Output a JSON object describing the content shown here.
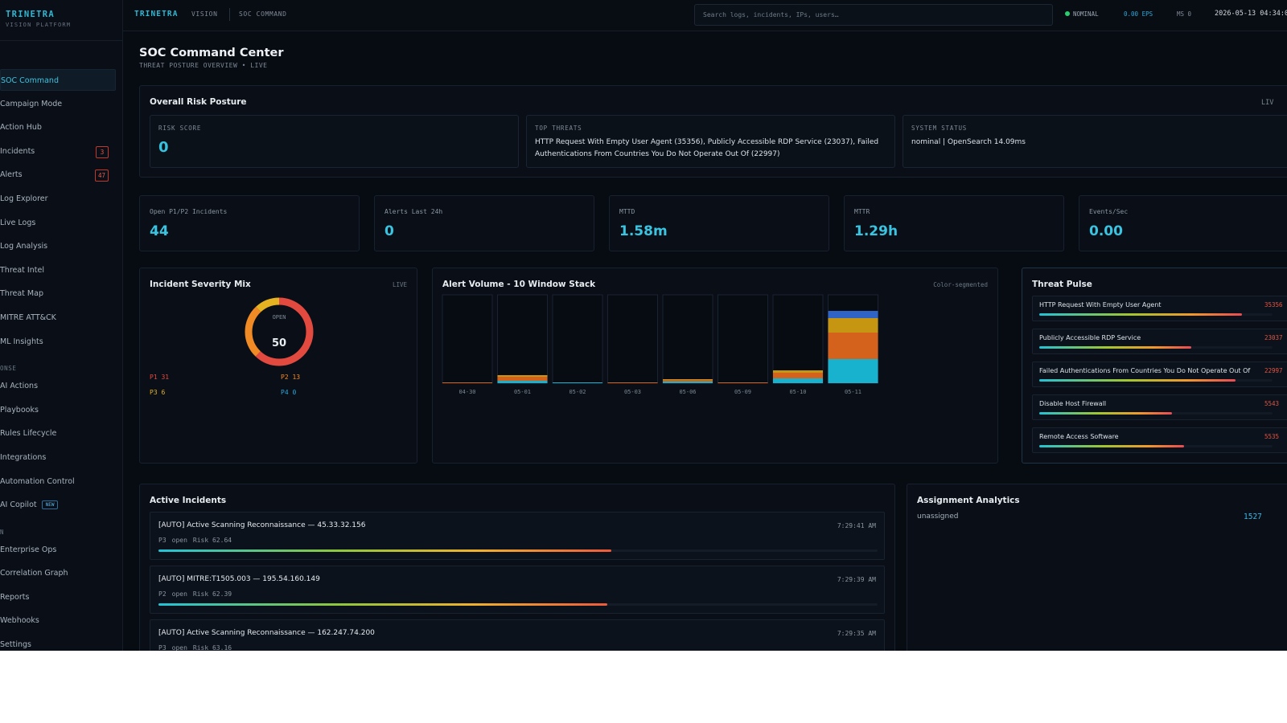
{
  "sidebar": {
    "brand": "TRINETRA",
    "brand_sub": "VISION PLATFORM",
    "items": [
      {
        "label": "SOC Command",
        "type": "item",
        "active": true
      },
      {
        "label": "Campaign Mode",
        "type": "item"
      },
      {
        "label": "Action Hub",
        "type": "item"
      },
      {
        "label": "Incidents",
        "type": "item",
        "badge": "3"
      },
      {
        "label": "Alerts",
        "type": "item",
        "badge": "47"
      },
      {
        "label": "Log Explorer",
        "type": "item"
      },
      {
        "label": "Live Logs",
        "type": "item"
      },
      {
        "label": "Log Analysis",
        "type": "item"
      },
      {
        "label": "Threat Intel",
        "type": "item"
      },
      {
        "label": "Threat Map",
        "type": "item"
      },
      {
        "label": "MITRE ATT&CK",
        "type": "item"
      },
      {
        "label": "ML Insights",
        "type": "item"
      },
      {
        "label": "ONSE",
        "type": "section"
      },
      {
        "label": "AI Actions",
        "type": "item"
      },
      {
        "label": "Playbooks",
        "type": "item"
      },
      {
        "label": "Rules Lifecycle",
        "type": "item"
      },
      {
        "label": "Integrations",
        "type": "item"
      },
      {
        "label": "Automation Control",
        "type": "item"
      },
      {
        "label": "AI Copilot",
        "type": "item",
        "tag": "NEW"
      },
      {
        "label": "N",
        "type": "section"
      },
      {
        "label": "Enterprise Ops",
        "type": "item"
      },
      {
        "label": "Correlation Graph",
        "type": "item"
      },
      {
        "label": "Reports",
        "type": "item"
      },
      {
        "label": "Webhooks",
        "type": "item"
      },
      {
        "label": "Settings",
        "type": "item"
      }
    ]
  },
  "topbar": {
    "brand": "TRINETRA",
    "vision": "VISION",
    "section": "SOC COMMAND",
    "search_placeholder": "Search logs, incidents, IPs, users…",
    "status": "NOMINAL",
    "eps": "0.00 EPS",
    "ms": "MS 0",
    "timestamp": "2026-05-13 04:34:0",
    "colors": {
      "status_dot": "#2ecc71",
      "accent": "#2fb8d4"
    }
  },
  "page": {
    "title": "SOC Command Center",
    "subtitle": "THREAT POSTURE OVERVIEW • LIVE"
  },
  "risk_posture": {
    "title": "Overall Risk Posture",
    "live": "LIV",
    "risk_score_label": "RISK SCORE",
    "risk_score": "0",
    "top_threats_label": "TOP THREATS",
    "top_threats": "HTTP Request With Empty User Agent (35356), Publicly Accessible RDP Service (23037), Failed Authentications From Countries You Do Not Operate Out Of (22997)",
    "system_status_label": "SYSTEM STATUS",
    "system_status": "nominal | OpenSearch 14.09ms"
  },
  "kpis": [
    {
      "label": "Open P1/P2 Incidents",
      "value": "44"
    },
    {
      "label": "Alerts Last 24h",
      "value": "0"
    },
    {
      "label": "MTTD",
      "value": "1.58m"
    },
    {
      "label": "MTTR",
      "value": "1.29h"
    },
    {
      "label": "Events/Sec",
      "value": "0.00"
    }
  ],
  "severity": {
    "title": "Incident Severity Mix",
    "tag": "LIVE",
    "center_label": "OPEN",
    "center_value": "50",
    "legend": [
      {
        "label": "P1 31",
        "color": "#e2493f"
      },
      {
        "label": "P2 13",
        "color": "#f08a24"
      },
      {
        "label": "P3 6",
        "color": "#e5b321"
      },
      {
        "label": "P4 0",
        "color": "#2aa6d9"
      }
    ],
    "chart_data": {
      "type": "pie",
      "labels": [
        "P1",
        "P2",
        "P3",
        "P4"
      ],
      "values": [
        31,
        13,
        6,
        0
      ],
      "colors": [
        "#e2493f",
        "#f08a24",
        "#e5b321",
        "#2aa6d9"
      ]
    }
  },
  "volume": {
    "title": "Alert Volume - 10 Window Stack",
    "tag": "Color-segmented",
    "chart_data": {
      "type": "bar",
      "stacked": true,
      "categories": [
        "04-30",
        "05-01",
        "05-02",
        "05-03",
        "05-06",
        "05-09",
        "05-10",
        "05-11"
      ],
      "series": [
        {
          "values": [
            0,
            3,
            1,
            0,
            2,
            0,
            6,
            30
          ],
          "color": "#18b2cf"
        },
        {
          "values": [
            1,
            5,
            0,
            1,
            2,
            1,
            7,
            33
          ],
          "color": "#d4621c"
        },
        {
          "values": [
            0,
            2,
            0,
            0,
            1,
            0,
            3,
            18
          ],
          "color": "#c69612"
        },
        {
          "values": [
            0,
            0,
            0,
            0,
            0,
            0,
            0,
            9
          ],
          "color": "#2f63c6"
        }
      ],
      "ylim": [
        0,
        110
      ]
    }
  },
  "pulse": {
    "title": "Threat Pulse",
    "items": [
      {
        "name": "HTTP Request With Empty User Agent",
        "count": "35356",
        "fraction": 0.87
      },
      {
        "name": "Publicly Accessible RDP Service",
        "count": "23037",
        "fraction": 0.65
      },
      {
        "name": "Failed Authentications From Countries You Do Not Operate Out Of",
        "count": "22997",
        "fraction": 0.84
      },
      {
        "name": "Disable Host Firewall",
        "count": "5543",
        "fraction": 0.57
      },
      {
        "name": "Remote Access Software",
        "count": "5535",
        "fraction": 0.62
      }
    ]
  },
  "incidents": {
    "title": "Active Incidents",
    "items": [
      {
        "title": "[AUTO] Active Scanning Reconnaissance — 45.33.32.156",
        "time": "7:29:41 AM",
        "priority": "P3",
        "status": "open",
        "risk": "Risk 62.64",
        "fraction": 0.63
      },
      {
        "title": "[AUTO] MITRE:T1505.003 — 195.54.160.149",
        "time": "7:29:39 AM",
        "priority": "P2",
        "status": "open",
        "risk": "Risk 62.39",
        "fraction": 0.624
      },
      {
        "title": "[AUTO] Active Scanning Reconnaissance — 162.247.74.200",
        "time": "7:29:35 AM",
        "priority": "P3",
        "status": "open",
        "risk": "Risk 63.16",
        "fraction": 0.63
      }
    ]
  },
  "assignment": {
    "title": "Assignment Analytics",
    "label": "unassigned",
    "value": "1527"
  }
}
